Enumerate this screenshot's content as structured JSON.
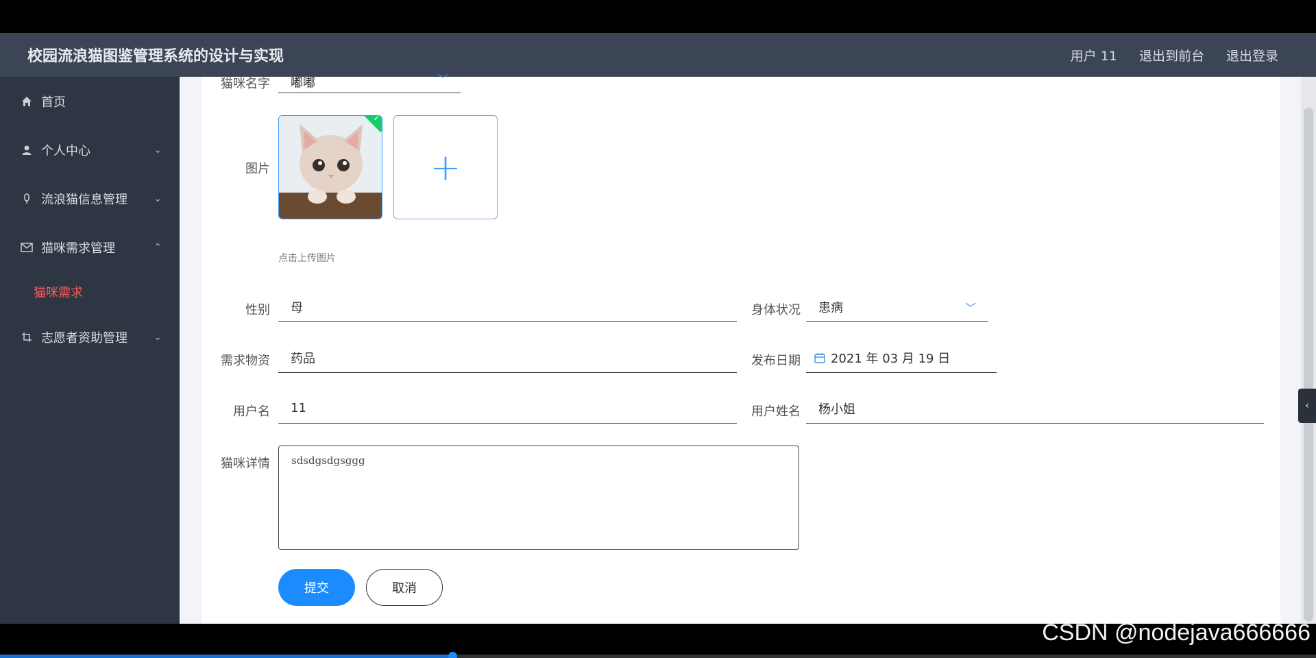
{
  "header": {
    "title": "校园流浪猫图鉴管理系统的设计与实现",
    "user_label": "用户 11",
    "exit_frontend": "退出到前台",
    "logout": "退出登录"
  },
  "sidebar": {
    "items": [
      {
        "label": "首页",
        "icon": "home-icon"
      },
      {
        "label": "个人中心",
        "icon": "user-icon",
        "expandable": true
      },
      {
        "label": "流浪猫信息管理",
        "icon": "mic-icon",
        "expandable": true
      },
      {
        "label": "猫咪需求管理",
        "icon": "envelope-icon",
        "expanded": true
      },
      {
        "label": "志愿者资助管理",
        "icon": "crop-icon",
        "expandable": true
      }
    ],
    "active_sub": "猫咪需求"
  },
  "form": {
    "cat_name": {
      "label": "猫咪名字",
      "value": "嘟嘟"
    },
    "image": {
      "label": "图片",
      "hint": "点击上传图片"
    },
    "gender": {
      "label": "性别",
      "value": "母"
    },
    "health": {
      "label": "身体状况",
      "value": "患病"
    },
    "need_items": {
      "label": "需求物资",
      "value": "药品"
    },
    "publish_date": {
      "label": "发布日期",
      "value": "2021 年 03 月 19 日"
    },
    "username": {
      "label": "用户名",
      "value": "11"
    },
    "real_name": {
      "label": "用户姓名",
      "value": "杨小姐"
    },
    "details": {
      "label": "猫咪详情",
      "value": "sdsdgsdgsggg"
    },
    "submit": "提交",
    "cancel": "取消"
  },
  "watermark": "CSDN @nodejava666666",
  "video_progress": 0.344,
  "colors": {
    "accent": "#1a8cff",
    "active_sub": "#ff5a5a",
    "header_bg": "#3c4555",
    "sidebar_bg": "#2f3643"
  }
}
